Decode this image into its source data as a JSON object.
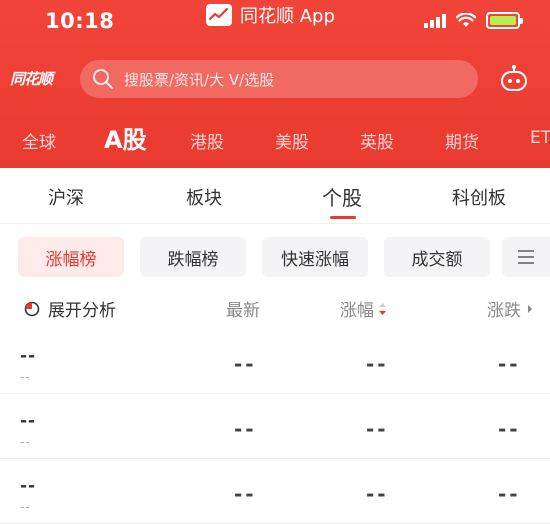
{
  "status_bar": {
    "time": "10:18",
    "app_name": "同花顺 App"
  },
  "header": {
    "logo_text": "同花顺",
    "search_placeholder": "搜股票/资讯/大 V/选股"
  },
  "market_tabs": [
    {
      "label": "全球",
      "active": false
    },
    {
      "label": "A股",
      "active": true
    },
    {
      "label": "港股",
      "active": false
    },
    {
      "label": "美股",
      "active": false
    },
    {
      "label": "英股",
      "active": false
    },
    {
      "label": "期货",
      "active": false
    },
    {
      "label": "ET",
      "active": false
    }
  ],
  "sub_tabs": [
    {
      "label": "沪深",
      "active": false
    },
    {
      "label": "板块",
      "active": false
    },
    {
      "label": "个股",
      "active": true
    },
    {
      "label": "科创板",
      "active": false
    }
  ],
  "filter_chips": [
    {
      "label": "涨幅榜",
      "active": true
    },
    {
      "label": "跌幅榜",
      "active": false
    },
    {
      "label": "快速涨幅",
      "active": false
    },
    {
      "label": "成交额",
      "active": false
    }
  ],
  "columns": {
    "expand_label": "展开分析",
    "latest": "最新",
    "change_pct": "涨幅",
    "change": "涨跌"
  },
  "rows": [
    {
      "name": "--",
      "code": "--",
      "latest": "--",
      "change_pct": "--",
      "change": "--"
    },
    {
      "name": "--",
      "code": "--",
      "latest": "--",
      "change_pct": "--",
      "change": "--"
    },
    {
      "name": "--",
      "code": "--",
      "latest": "--",
      "change_pct": "--",
      "change": "--"
    }
  ],
  "colors": {
    "brand_red": "#ea3a30",
    "active_chip_bg": "#fdeaea",
    "battery_green": "#b6f04f"
  }
}
